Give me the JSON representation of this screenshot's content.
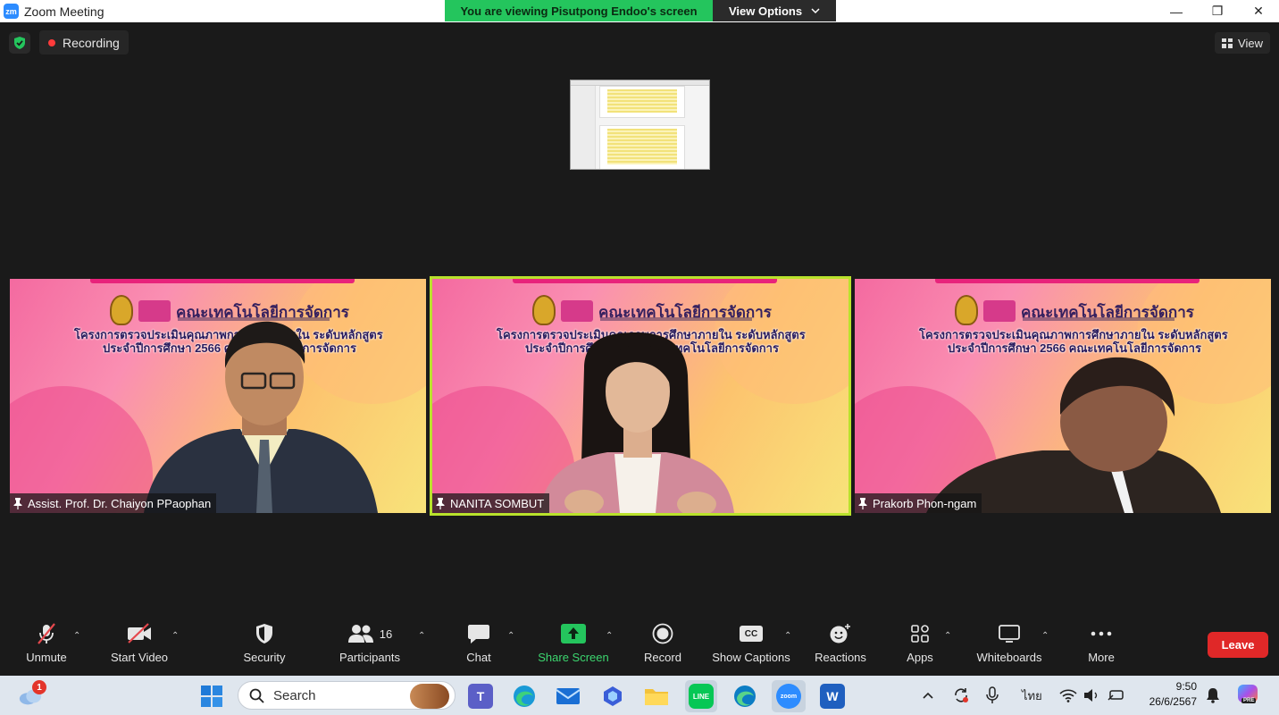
{
  "window": {
    "app_icon_text": "zm",
    "title": "Zoom Meeting",
    "minimize": "—",
    "restore": "❐",
    "close": "✕"
  },
  "banner": {
    "viewing_text": "You are viewing Pisutpong Endoo's screen",
    "view_options_label": "View Options"
  },
  "top": {
    "recording_label": "Recording",
    "view_label": "View"
  },
  "tiles": [
    {
      "participant": "Assist. Prof. Dr. Chaiyon PPaophan",
      "faculty": "คณะเทคโนโลยีการจัดการ",
      "project_line1": "โครงการตรวจประเมินคุณภาพการศึกษาภายใน ระดับหลักสูตร",
      "project_line2": "ประจำปีการศึกษา 2566 คณะเทคโนโลยีการจัดการ"
    },
    {
      "participant": "NANITA SOMBUT",
      "faculty": "คณะเทคโนโลยีการจัดการ",
      "project_line1": "โครงการตรวจประเมินคุณภาพการศึกษาภายใน ระดับหลักสูตร",
      "project_line2": "ประจำปีการศึกษา 2566 คณะเทคโนโลยีการจัดการ"
    },
    {
      "participant": "Prakorb Phon-ngam",
      "faculty": "คณะเทคโนโลยีการจัดการ",
      "project_line1": "โครงการตรวจประเมินคุณภาพการศึกษาภายใน ระดับหลักสูตร",
      "project_line2": "ประจำปีการศึกษา 2566 คณะเทคโนโลยีการจัดการ"
    }
  ],
  "toolbar": {
    "unmute": "Unmute",
    "start_video": "Start Video",
    "security": "Security",
    "participants": "Participants",
    "participants_count": "16",
    "chat": "Chat",
    "share_screen": "Share Screen",
    "record": "Record",
    "show_captions": "Show Captions",
    "captions_icon_text": "CC",
    "reactions": "Reactions",
    "apps": "Apps",
    "whiteboards": "Whiteboards",
    "more": "More",
    "leave": "Leave"
  },
  "taskbar": {
    "search_placeholder": "Search",
    "notification_count": "1",
    "zoom_icon_text": "zoom",
    "word_icon_text": "W",
    "line_icon_text": "LINE",
    "teams_icon_text": "T",
    "language": "ไทย",
    "time": "9:50",
    "date": "26/6/2567",
    "copilot_badge": "PRE"
  },
  "colors": {
    "accent_green": "#24c55d",
    "active_border": "#b9e22c",
    "leave_red": "#e02828",
    "zoom_blue": "#2d8cff"
  }
}
